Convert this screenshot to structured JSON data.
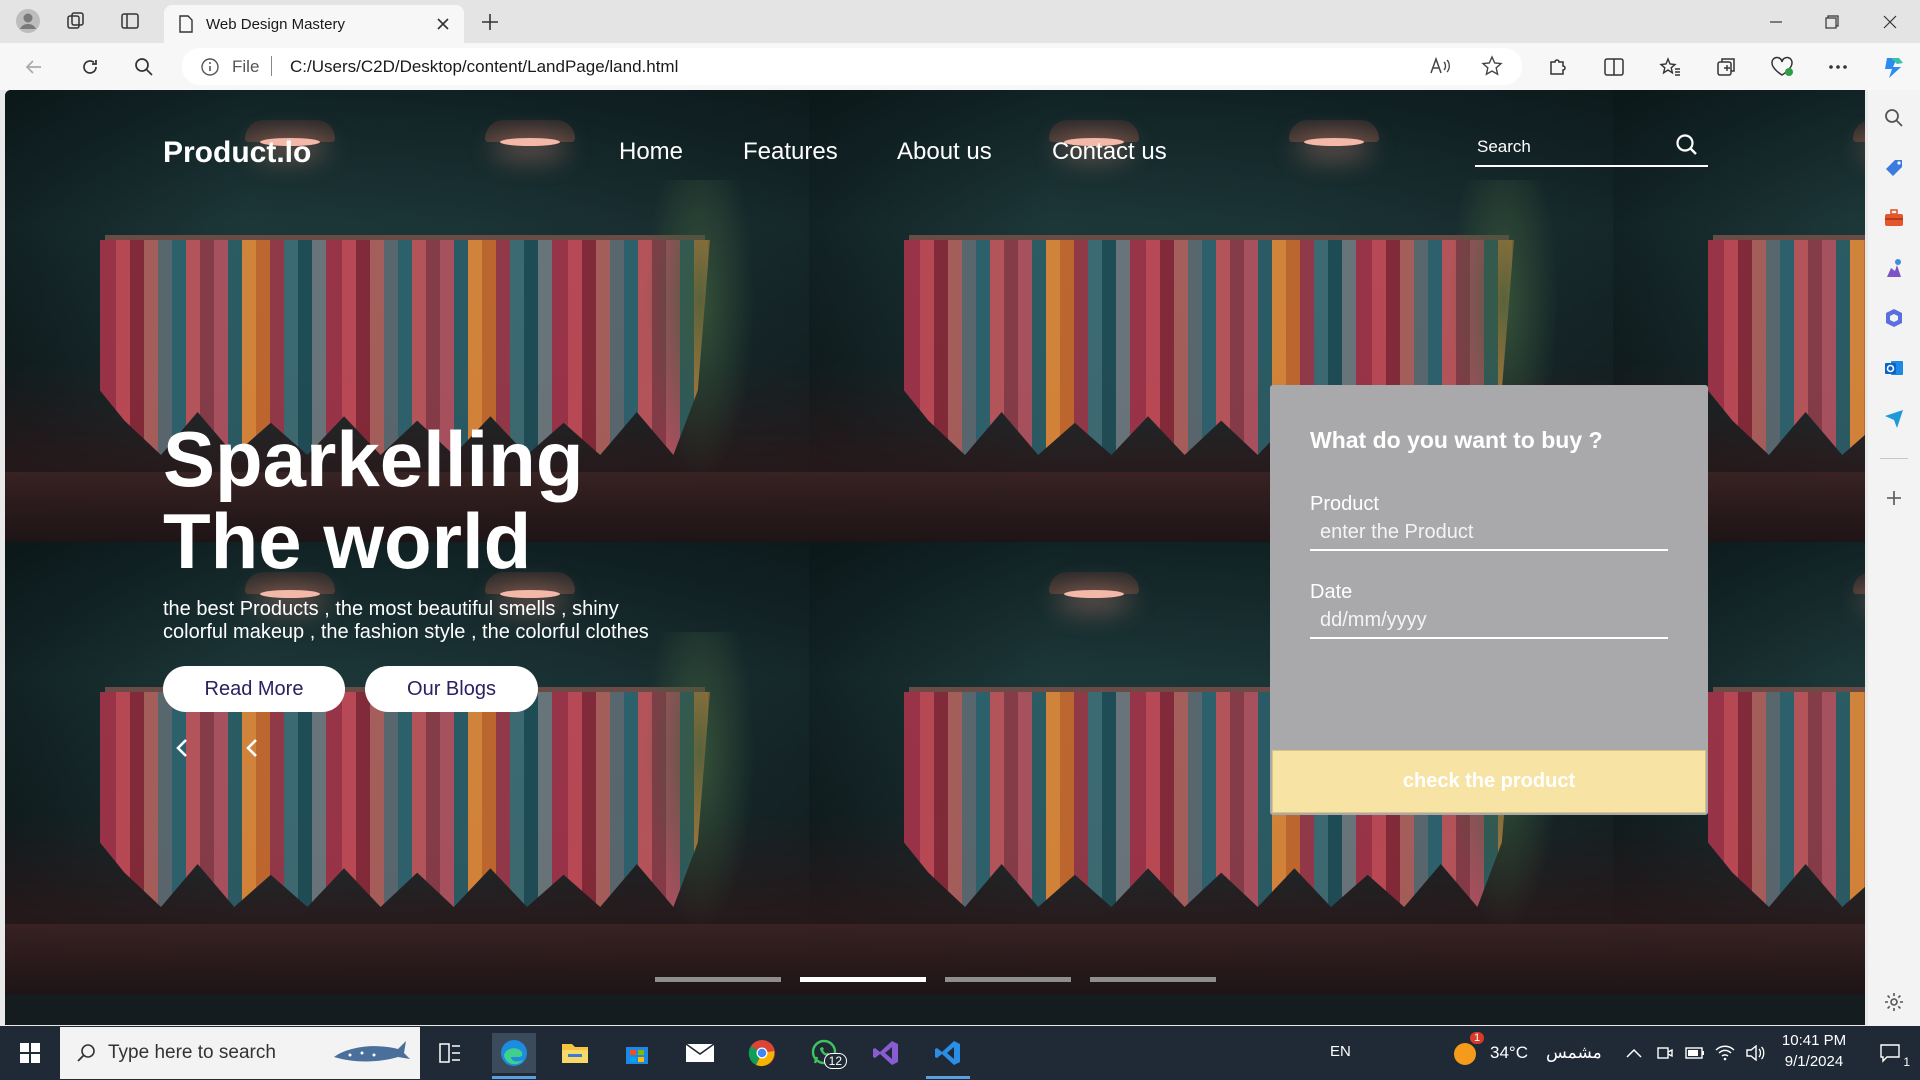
{
  "browser": {
    "tab_title": "Web Design Mastery",
    "address_prefix": "File",
    "url": "C:/Users/C2D/Desktop/content/LandPage/land.html"
  },
  "site": {
    "logo": "Product.lo",
    "nav": [
      "Home",
      "Features",
      "About us",
      "Contact us"
    ],
    "search_placeholder": "Search",
    "hero_title_line1": "Sparkelling",
    "hero_title_line2": "The world",
    "hero_subtitle": "the best Products , the most beautiful smells , shiny colorful makeup , the fashion style , the colorful clothes",
    "read_more": "Read More",
    "our_blogs": "Our Blogs",
    "slider_dots": 4,
    "active_dot_index": 1
  },
  "form": {
    "title": "What do you want to buy ?",
    "product_label": "Product",
    "product_placeholder": "enter the Product",
    "date_label": "Date",
    "date_placeholder": "dd/mm/yyyy",
    "submit_label": "check the product"
  },
  "taskbar": {
    "search_placeholder": "Type here to search",
    "language": "EN",
    "weather_temp": "34°C",
    "weather_desc": "مشمس",
    "weather_badge": "1",
    "whatsapp_badge": "12",
    "time": "10:41 PM",
    "date": "9/1/2024",
    "notification_count": "1"
  },
  "colors": {
    "card_bg": "#a9a9ab",
    "card_button_bg": "#f7e3a4",
    "pill_text": "#2c2060",
    "taskbar_bg": "#1f2a36"
  }
}
